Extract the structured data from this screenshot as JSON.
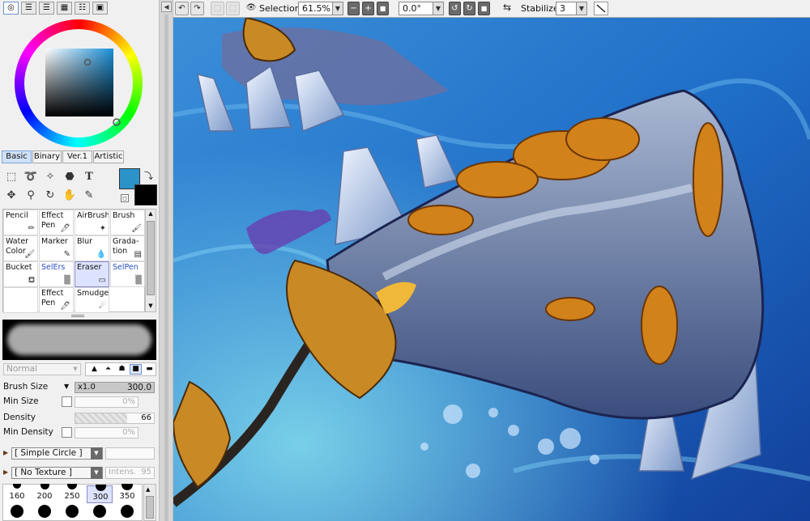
{
  "toolbar": {
    "selection_label": "Selection",
    "zoom_value": "61.5%",
    "rotation_value": "0.0°",
    "stabilizer_label": "Stabilizer",
    "stabilizer_value": "3",
    "minus": "−",
    "plus": "+"
  },
  "tabs": [
    "Basic",
    "Binary",
    "Ver.1",
    "Artistic"
  ],
  "tools": [
    {
      "l1": "Pencil",
      "l2": ""
    },
    {
      "l1": "Effect",
      "l2": "Pen"
    },
    {
      "l1": "AirBrush",
      "l2": ""
    },
    {
      "l1": "Brush",
      "l2": ""
    },
    {
      "l1": "Water",
      "l2": "Color"
    },
    {
      "l1": "Marker",
      "l2": ""
    },
    {
      "l1": "Blur",
      "l2": ""
    },
    {
      "l1": "Grada-",
      "l2": "tion"
    },
    {
      "l1": "Bucket",
      "l2": ""
    },
    {
      "l1": "SelErs",
      "l2": ""
    },
    {
      "l1": "Eraser",
      "l2": ""
    },
    {
      "l1": "SelPen",
      "l2": ""
    },
    {
      "l1": "",
      "l2": ""
    },
    {
      "l1": "Effect",
      "l2": "Pen"
    },
    {
      "l1": "Smudge",
      "l2": ""
    }
  ],
  "brush": {
    "blend_mode": "Normal",
    "size_label": "Brush Size",
    "size_mult": "x1.0",
    "size_value": "300.0",
    "min_size_label": "Min Size",
    "min_size_value": "0%",
    "density_label": "Density",
    "density_value": "66",
    "min_density_label": "Min Density",
    "min_density_value": "0%",
    "shape": "[ Simple Circle ]",
    "texture": "[ No Texture ]",
    "intens_label": "Intens.",
    "intens_value": "95",
    "sizes": [
      "160",
      "200",
      "250",
      "300",
      "350"
    ]
  },
  "colors": {
    "primary": "#2b93c8",
    "secondary": "#000000"
  }
}
